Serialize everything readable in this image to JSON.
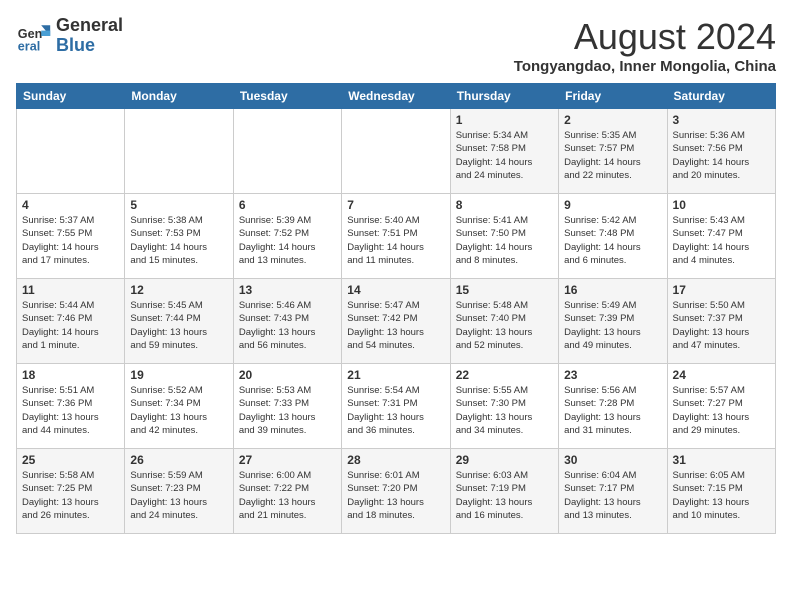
{
  "logo": {
    "general": "General",
    "blue": "Blue"
  },
  "title": {
    "month_year": "August 2024",
    "location": "Tongyangdao, Inner Mongolia, China"
  },
  "days_of_week": [
    "Sunday",
    "Monday",
    "Tuesday",
    "Wednesday",
    "Thursday",
    "Friday",
    "Saturday"
  ],
  "weeks": [
    [
      {
        "day": "",
        "info": ""
      },
      {
        "day": "",
        "info": ""
      },
      {
        "day": "",
        "info": ""
      },
      {
        "day": "",
        "info": ""
      },
      {
        "day": "1",
        "info": "Sunrise: 5:34 AM\nSunset: 7:58 PM\nDaylight: 14 hours\nand 24 minutes."
      },
      {
        "day": "2",
        "info": "Sunrise: 5:35 AM\nSunset: 7:57 PM\nDaylight: 14 hours\nand 22 minutes."
      },
      {
        "day": "3",
        "info": "Sunrise: 5:36 AM\nSunset: 7:56 PM\nDaylight: 14 hours\nand 20 minutes."
      }
    ],
    [
      {
        "day": "4",
        "info": "Sunrise: 5:37 AM\nSunset: 7:55 PM\nDaylight: 14 hours\nand 17 minutes."
      },
      {
        "day": "5",
        "info": "Sunrise: 5:38 AM\nSunset: 7:53 PM\nDaylight: 14 hours\nand 15 minutes."
      },
      {
        "day": "6",
        "info": "Sunrise: 5:39 AM\nSunset: 7:52 PM\nDaylight: 14 hours\nand 13 minutes."
      },
      {
        "day": "7",
        "info": "Sunrise: 5:40 AM\nSunset: 7:51 PM\nDaylight: 14 hours\nand 11 minutes."
      },
      {
        "day": "8",
        "info": "Sunrise: 5:41 AM\nSunset: 7:50 PM\nDaylight: 14 hours\nand 8 minutes."
      },
      {
        "day": "9",
        "info": "Sunrise: 5:42 AM\nSunset: 7:48 PM\nDaylight: 14 hours\nand 6 minutes."
      },
      {
        "day": "10",
        "info": "Sunrise: 5:43 AM\nSunset: 7:47 PM\nDaylight: 14 hours\nand 4 minutes."
      }
    ],
    [
      {
        "day": "11",
        "info": "Sunrise: 5:44 AM\nSunset: 7:46 PM\nDaylight: 14 hours\nand 1 minute."
      },
      {
        "day": "12",
        "info": "Sunrise: 5:45 AM\nSunset: 7:44 PM\nDaylight: 13 hours\nand 59 minutes."
      },
      {
        "day": "13",
        "info": "Sunrise: 5:46 AM\nSunset: 7:43 PM\nDaylight: 13 hours\nand 56 minutes."
      },
      {
        "day": "14",
        "info": "Sunrise: 5:47 AM\nSunset: 7:42 PM\nDaylight: 13 hours\nand 54 minutes."
      },
      {
        "day": "15",
        "info": "Sunrise: 5:48 AM\nSunset: 7:40 PM\nDaylight: 13 hours\nand 52 minutes."
      },
      {
        "day": "16",
        "info": "Sunrise: 5:49 AM\nSunset: 7:39 PM\nDaylight: 13 hours\nand 49 minutes."
      },
      {
        "day": "17",
        "info": "Sunrise: 5:50 AM\nSunset: 7:37 PM\nDaylight: 13 hours\nand 47 minutes."
      }
    ],
    [
      {
        "day": "18",
        "info": "Sunrise: 5:51 AM\nSunset: 7:36 PM\nDaylight: 13 hours\nand 44 minutes."
      },
      {
        "day": "19",
        "info": "Sunrise: 5:52 AM\nSunset: 7:34 PM\nDaylight: 13 hours\nand 42 minutes."
      },
      {
        "day": "20",
        "info": "Sunrise: 5:53 AM\nSunset: 7:33 PM\nDaylight: 13 hours\nand 39 minutes."
      },
      {
        "day": "21",
        "info": "Sunrise: 5:54 AM\nSunset: 7:31 PM\nDaylight: 13 hours\nand 36 minutes."
      },
      {
        "day": "22",
        "info": "Sunrise: 5:55 AM\nSunset: 7:30 PM\nDaylight: 13 hours\nand 34 minutes."
      },
      {
        "day": "23",
        "info": "Sunrise: 5:56 AM\nSunset: 7:28 PM\nDaylight: 13 hours\nand 31 minutes."
      },
      {
        "day": "24",
        "info": "Sunrise: 5:57 AM\nSunset: 7:27 PM\nDaylight: 13 hours\nand 29 minutes."
      }
    ],
    [
      {
        "day": "25",
        "info": "Sunrise: 5:58 AM\nSunset: 7:25 PM\nDaylight: 13 hours\nand 26 minutes."
      },
      {
        "day": "26",
        "info": "Sunrise: 5:59 AM\nSunset: 7:23 PM\nDaylight: 13 hours\nand 24 minutes."
      },
      {
        "day": "27",
        "info": "Sunrise: 6:00 AM\nSunset: 7:22 PM\nDaylight: 13 hours\nand 21 minutes."
      },
      {
        "day": "28",
        "info": "Sunrise: 6:01 AM\nSunset: 7:20 PM\nDaylight: 13 hours\nand 18 minutes."
      },
      {
        "day": "29",
        "info": "Sunrise: 6:03 AM\nSunset: 7:19 PM\nDaylight: 13 hours\nand 16 minutes."
      },
      {
        "day": "30",
        "info": "Sunrise: 6:04 AM\nSunset: 7:17 PM\nDaylight: 13 hours\nand 13 minutes."
      },
      {
        "day": "31",
        "info": "Sunrise: 6:05 AM\nSunset: 7:15 PM\nDaylight: 13 hours\nand 10 minutes."
      }
    ]
  ]
}
